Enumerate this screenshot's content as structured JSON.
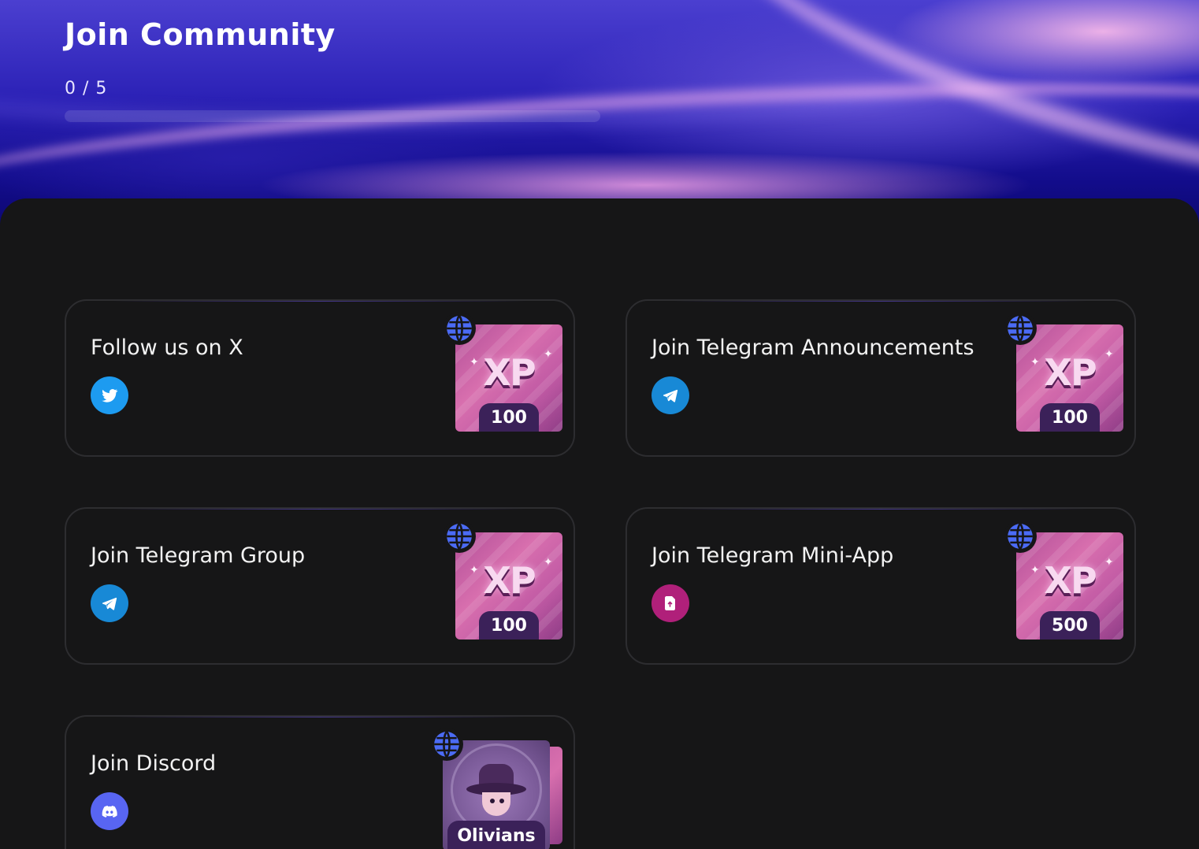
{
  "header": {
    "title": "Join Community",
    "progress_text": "0 / 5",
    "progress_fraction": 0
  },
  "quests": [
    {
      "title": "Follow us on X",
      "platform_icon": "twitter-icon",
      "platform_color": "#1d9bf0",
      "reward_type": "XP",
      "reward_amount": "100"
    },
    {
      "title": "Join Telegram Announcements",
      "platform_icon": "telegram-icon",
      "platform_color": "#1889d6",
      "reward_type": "XP",
      "reward_amount": "100"
    },
    {
      "title": "Join Telegram Group",
      "platform_icon": "telegram-icon",
      "platform_color": "#1889d6",
      "reward_type": "XP",
      "reward_amount": "100"
    },
    {
      "title": "Join Telegram Mini-App",
      "platform_icon": "mini-app-icon",
      "platform_color": "#b0207a",
      "reward_type": "XP",
      "reward_amount": "500"
    },
    {
      "title": "Join Discord",
      "platform_icon": "discord-icon",
      "platform_color": "#5865f2",
      "reward_type": "avatar",
      "reward_name": "Olivians"
    }
  ],
  "colors": {
    "background": "#161617",
    "card_border": "#2d2d30",
    "badge": "#3b2159",
    "globe": "#4b6bf5"
  }
}
